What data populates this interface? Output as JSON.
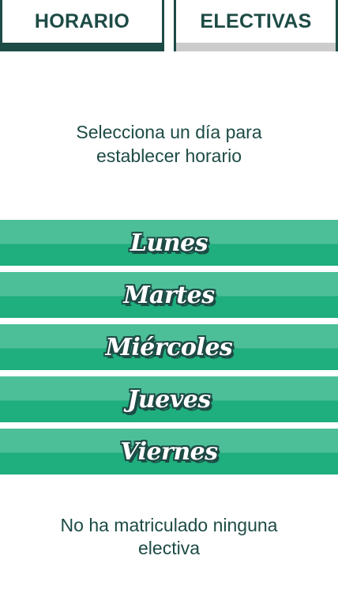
{
  "tabs": [
    {
      "label": "HORARIO",
      "active": true
    },
    {
      "label": "ELECTIVAS",
      "active": false
    }
  ],
  "instruction": {
    "line1": "Selecciona un día para",
    "line2": "establecer horario"
  },
  "days": [
    {
      "label": "Lunes"
    },
    {
      "label": "Martes"
    },
    {
      "label": "Miércoles"
    },
    {
      "label": "Jueves"
    },
    {
      "label": "Viernes"
    }
  ],
  "electives_note": {
    "line1": "No ha matriculado ninguna",
    "line2": "electiva"
  },
  "colors": {
    "primary_dark": "#1d4b45",
    "button_top": "#4cbf98",
    "button_bottom": "#1fae7d",
    "inactive_underline": "#cccccc"
  }
}
